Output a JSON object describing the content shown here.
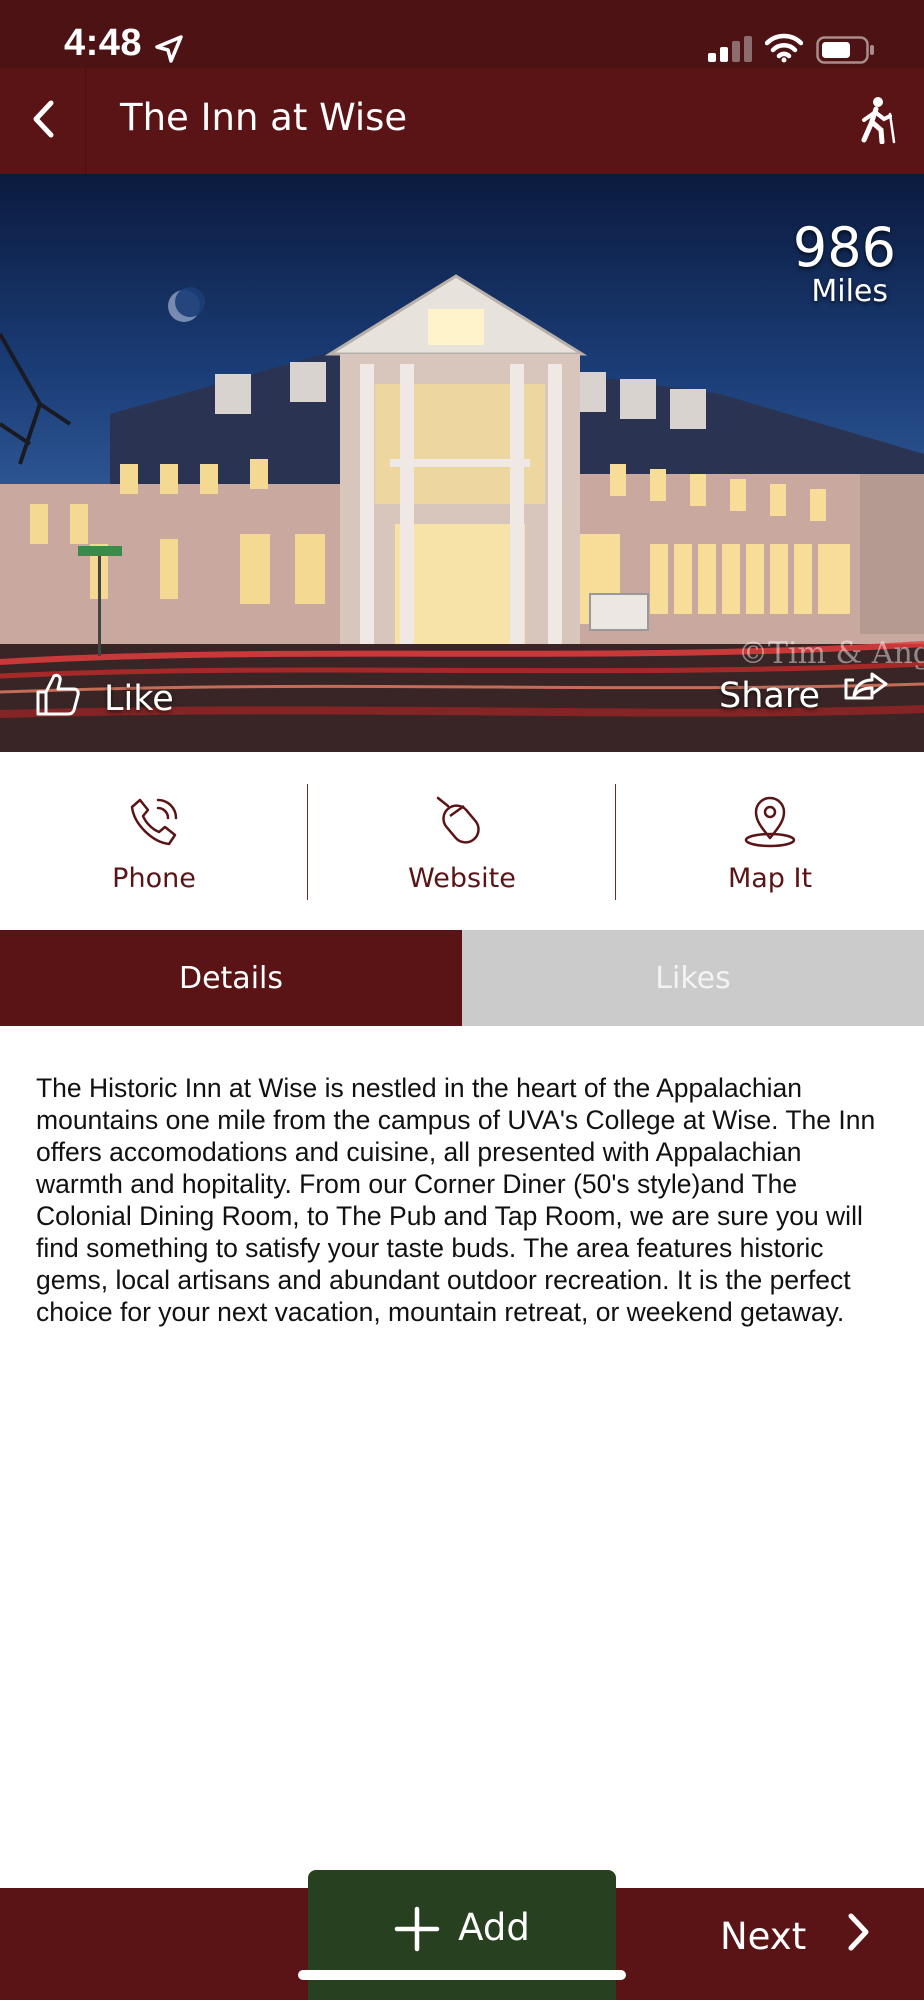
{
  "status_bar": {
    "time": "4:48",
    "icons": [
      "location-arrow-icon",
      "cellular-signal-icon",
      "wifi-icon",
      "battery-icon"
    ]
  },
  "header": {
    "title": "The Inn at Wise",
    "back_icon": "chevron-left-icon",
    "right_icon": "hiker-icon"
  },
  "hero": {
    "distance_value": "986",
    "distance_unit": "Miles",
    "like_label": "Like",
    "share_label": "Share",
    "watermark": "©Tim & Ang"
  },
  "actions": {
    "phone_label": "Phone",
    "website_label": "Website",
    "map_label": "Map It"
  },
  "tabs": {
    "details_label": "Details",
    "likes_label": "Likes",
    "active": "Details"
  },
  "description": "The Historic Inn at Wise is nestled in the heart of the Appalachian mountains one mile from the campus of UVA's College at Wise. The Inn offers accomodations and cuisine, all presented with Appalachian warmth and hopitality. From our Corner Diner (50's style)and The Colonial Dining Room, to The Pub and Tap Room, we are sure you will find something to satisfy your taste buds. The area features historic gems, local artisans and abundant outdoor recreation. It is the perfect choice for your next vacation, mountain retreat, or weekend getaway.",
  "bottom_bar": {
    "add_label": "Add",
    "next_label": "Next"
  },
  "colors": {
    "brand_maroon": "#5b1416",
    "status_maroon": "#4d1314",
    "add_green": "#27401f",
    "tab_inactive": "#cbcbcb"
  }
}
